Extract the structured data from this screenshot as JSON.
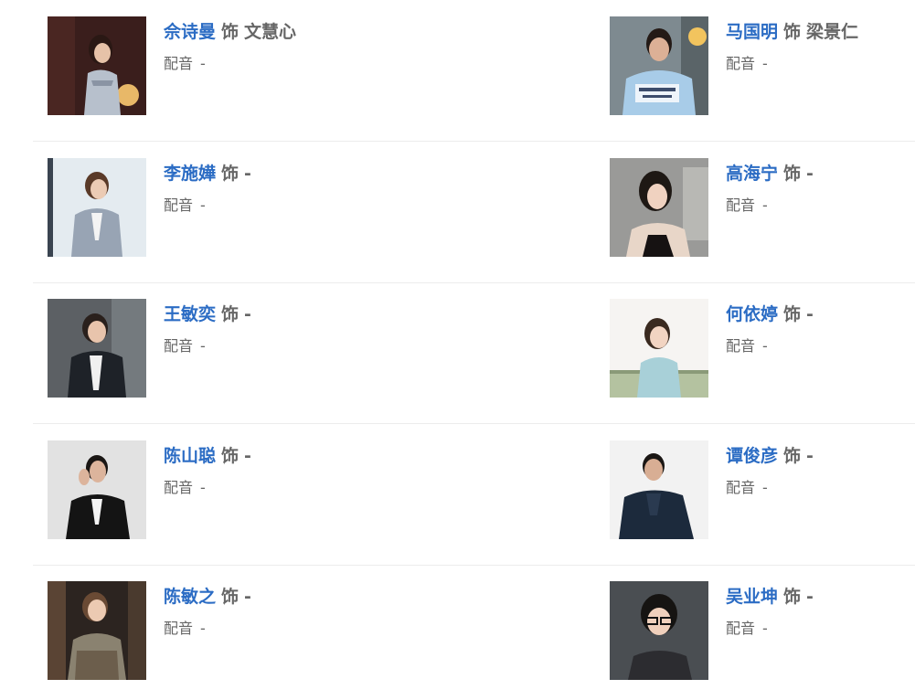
{
  "connector": "饰",
  "voice_label": "配音",
  "rows": [
    {
      "left": {
        "actor": "佘诗曼",
        "role": "文慧心",
        "voice_actor": "-"
      },
      "right": {
        "actor": "马国明",
        "role": "梁景仁",
        "voice_actor": "-"
      }
    },
    {
      "left": {
        "actor": "李施嬅",
        "role": "-",
        "voice_actor": "-"
      },
      "right": {
        "actor": "高海宁",
        "role": "-",
        "voice_actor": "-"
      }
    },
    {
      "left": {
        "actor": "王敏奕",
        "role": "-",
        "voice_actor": "-"
      },
      "right": {
        "actor": "何依婷",
        "role": "-",
        "voice_actor": "-"
      }
    },
    {
      "left": {
        "actor": "陈山聪",
        "role": "-",
        "voice_actor": "-"
      },
      "right": {
        "actor": "谭俊彦",
        "role": "-",
        "voice_actor": "-"
      }
    },
    {
      "left": {
        "actor": "陈敏之",
        "role": "-",
        "voice_actor": "-"
      },
      "right": {
        "actor": "吴业坤",
        "role": "-",
        "voice_actor": "-"
      }
    }
  ]
}
